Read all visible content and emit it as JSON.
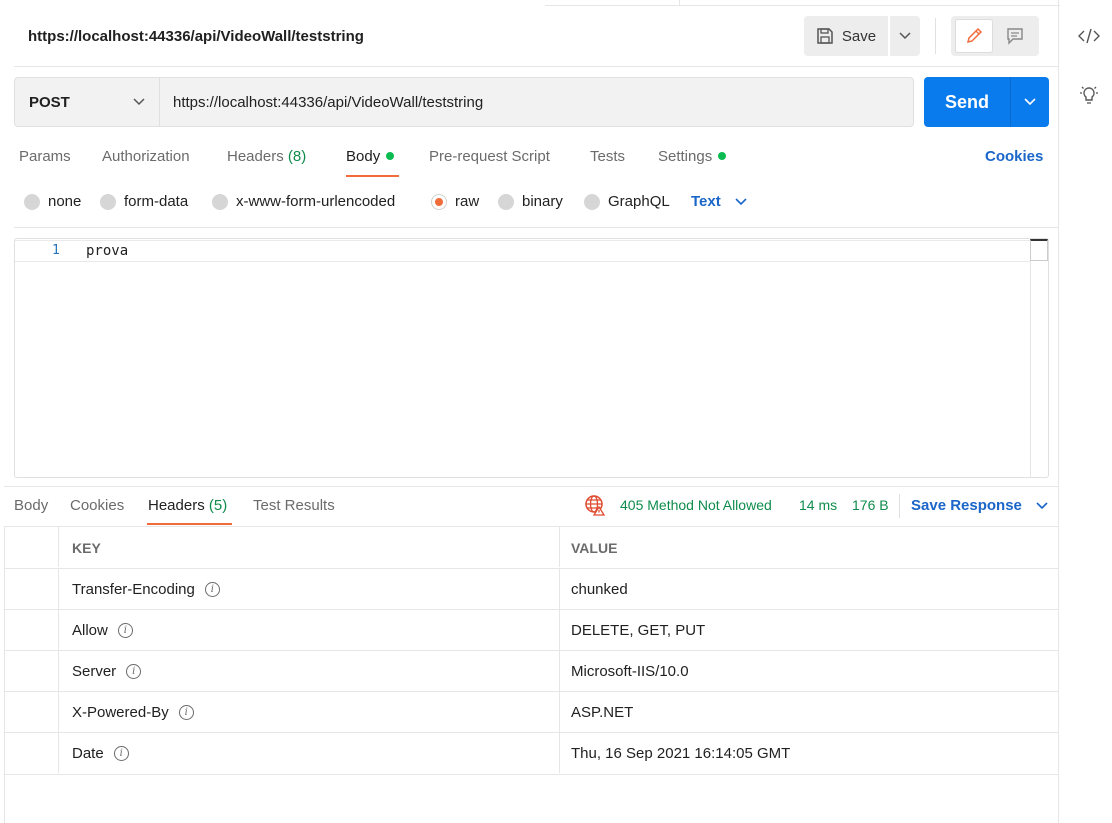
{
  "request": {
    "title": "https://localhost:44336/api/VideoWall/teststring",
    "save_label": "Save",
    "method": "POST",
    "url": "https://localhost:44336/api/VideoWall/teststring",
    "send_label": "Send"
  },
  "request_tabs": [
    {
      "label": "Params"
    },
    {
      "label": "Authorization"
    },
    {
      "label": "Headers",
      "count": "(8)"
    },
    {
      "label": "Body",
      "dot": true,
      "active": true
    },
    {
      "label": "Pre-request Script"
    },
    {
      "label": "Tests"
    },
    {
      "label": "Settings",
      "dot": true
    }
  ],
  "cookies_label": "Cookies",
  "body_types": [
    {
      "label": "none"
    },
    {
      "label": "form-data"
    },
    {
      "label": "x-www-form-urlencoded"
    },
    {
      "label": "raw",
      "selected": true
    },
    {
      "label": "binary"
    },
    {
      "label": "GraphQL"
    }
  ],
  "body_format": "Text",
  "editor": {
    "line_number": "1",
    "content": "prova"
  },
  "response_tabs": [
    {
      "label": "Body"
    },
    {
      "label": "Cookies"
    },
    {
      "label": "Headers",
      "count": "(5)",
      "active": true
    },
    {
      "label": "Test Results"
    }
  ],
  "response_status": {
    "status": "405 Method Not Allowed",
    "time": "14 ms",
    "size": "176 B"
  },
  "save_response_label": "Save Response",
  "headers_table": {
    "columns": [
      "KEY",
      "VALUE"
    ],
    "rows": [
      {
        "key": "Transfer-Encoding",
        "value": "chunked"
      },
      {
        "key": "Allow",
        "value": "DELETE, GET, PUT"
      },
      {
        "key": "Server",
        "value": "Microsoft-IIS/10.0"
      },
      {
        "key": "X-Powered-By",
        "value": "ASP.NET"
      },
      {
        "key": "Date",
        "value": "Thu, 16 Sep 2021 16:14:05 GMT"
      }
    ]
  },
  "colors": {
    "accent_orange": "#f26b3a",
    "send_blue": "#097bed",
    "link_blue": "#1a66c9",
    "status_green": "#0f8c4c",
    "dot_green": "#0cbb52"
  },
  "icons": [
    "save-icon",
    "chevron-down-icon",
    "pencil-icon",
    "comment-icon",
    "code-icon",
    "lightbulb-icon",
    "globe-icon",
    "info-icon"
  ]
}
